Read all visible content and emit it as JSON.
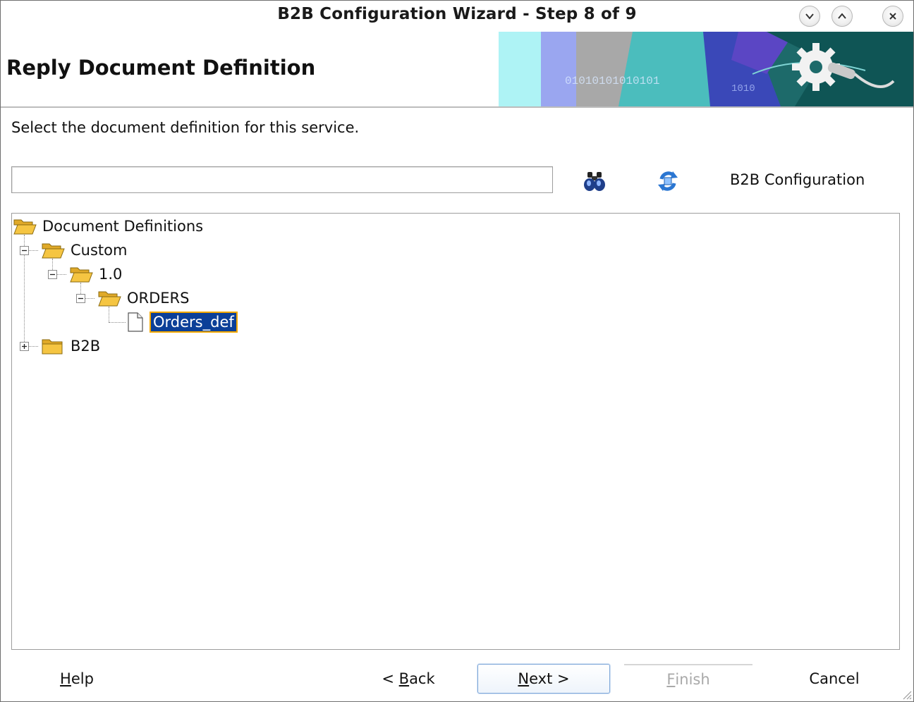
{
  "window": {
    "title": "B2B Configuration Wizard - Step 8 of 9"
  },
  "header": {
    "page_title": "Reply Document Definition",
    "banner_text_1": "01010101010101",
    "banner_text_2": "1010"
  },
  "body": {
    "instruction": "Select the document definition for this service.",
    "search": {
      "value": "",
      "placeholder": ""
    },
    "config_label": "B2B Configuration",
    "icons": {
      "search": "binoculars-icon",
      "refresh": "refresh-icon"
    }
  },
  "tree": {
    "root": "Document Definitions",
    "custom": "Custom",
    "version": "1.0",
    "orders": "ORDERS",
    "orders_def": "Orders_def",
    "b2b": "B2B"
  },
  "footer": {
    "help": {
      "mnemonic": "H",
      "rest": "elp"
    },
    "back": {
      "prefix": "< ",
      "mnemonic": "B",
      "rest": "ack"
    },
    "next": {
      "mnemonic": "N",
      "rest": "ext >"
    },
    "finish": {
      "mnemonic": "F",
      "rest": "inish"
    },
    "cancel": "Cancel"
  },
  "colors": {
    "selection": "#0b3f98",
    "selection_outline": "#f2a700",
    "folder": "#f5c542",
    "primary_border": "#7fa8d9"
  }
}
